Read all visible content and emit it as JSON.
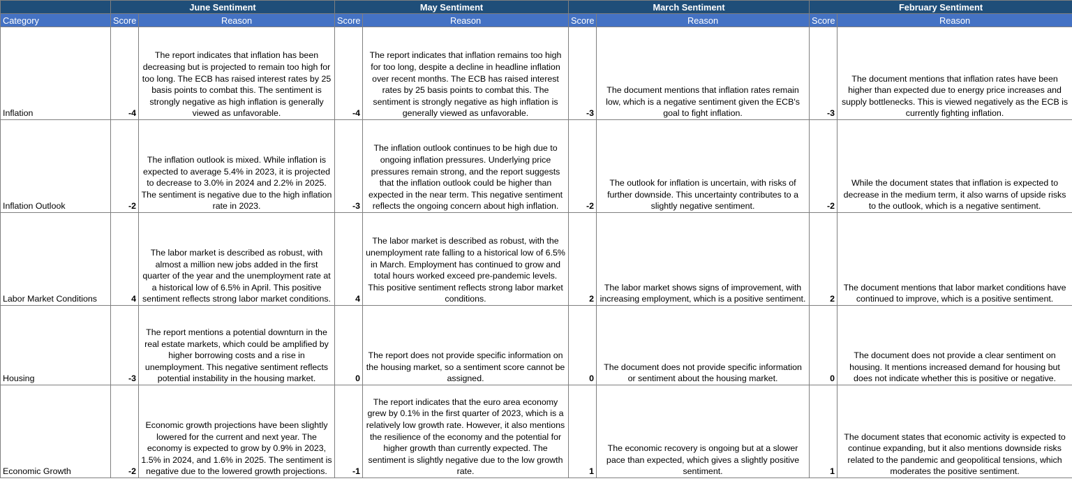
{
  "header": {
    "groups": [
      "June Sentiment",
      "May Sentiment",
      "March Sentiment",
      "February Sentiment"
    ],
    "category_label": "Category",
    "score_label": "Score",
    "reason_label": "Reason"
  },
  "rows": [
    {
      "category": "Inflation",
      "june": {
        "score": "-4",
        "reason": "The report indicates that inflation has been decreasing but is projected to remain too high for too long. The ECB has raised interest rates by 25 basis points to combat this. The sentiment is strongly negative as high inflation is generally viewed as unfavorable."
      },
      "may": {
        "score": "-4",
        "reason": "The report indicates that inflation remains too high for too long, despite a decline in headline inflation over recent months. The ECB has raised interest rates by 25 basis points to combat this. The sentiment is strongly negative as high inflation is generally viewed as unfavorable."
      },
      "march": {
        "score": "-3",
        "reason": "The document mentions that inflation rates remain low, which is a negative sentiment given the ECB's goal to fight inflation."
      },
      "february": {
        "score": "-3",
        "reason": "The document mentions that inflation rates have been higher than expected due to energy price increases and supply bottlenecks. This is viewed negatively as the ECB is currently fighting inflation."
      }
    },
    {
      "category": "Inflation Outlook",
      "june": {
        "score": "-2",
        "reason": "The inflation outlook is mixed. While inflation is expected to average 5.4% in 2023, it is projected to decrease to 3.0% in 2024 and 2.2% in 2025. The sentiment is negative due to the high inflation rate in 2023."
      },
      "may": {
        "score": "-3",
        "reason": "The inflation outlook continues to be high due to ongoing inflation pressures. Underlying price pressures remain strong, and the report suggests that the inflation outlook could be higher than expected in the near term. This negative sentiment reflects the ongoing concern about high inflation."
      },
      "march": {
        "score": "-2",
        "reason": "The outlook for inflation is uncertain, with risks of further downside. This uncertainty contributes to a slightly negative sentiment."
      },
      "february": {
        "score": "-2",
        "reason": "While the document states that inflation is expected to decrease in the medium term, it also warns of upside risks to the outlook, which is a negative sentiment."
      }
    },
    {
      "category": "Labor Market Conditions",
      "june": {
        "score": "4",
        "reason": "The labor market is described as robust, with almost a million new jobs added in the first quarter of the year and the unemployment rate at a historical low of 6.5% in April. This positive sentiment reflects strong labor market conditions."
      },
      "may": {
        "score": "4",
        "reason": "The labor market is described as robust, with the unemployment rate falling to a historical low of 6.5% in March. Employment has continued to grow and total hours worked exceed pre-pandemic levels. This positive sentiment reflects strong labor market conditions."
      },
      "march": {
        "score": "2",
        "reason": "The labor market shows signs of improvement, with increasing employment, which is a positive sentiment."
      },
      "february": {
        "score": "2",
        "reason": "The document mentions that labor market conditions have continued to improve, which is a positive sentiment."
      }
    },
    {
      "category": "Housing",
      "june": {
        "score": "-3",
        "reason": "The report mentions a potential downturn in the real estate markets, which could be amplified by higher borrowing costs and a rise in unemployment. This negative sentiment reflects potential instability in the housing market."
      },
      "may": {
        "score": "0",
        "reason": "The report does not provide specific information on the housing market, so a sentiment score cannot be assigned."
      },
      "march": {
        "score": "0",
        "reason": "The document does not provide specific information or sentiment about the housing market."
      },
      "february": {
        "score": "0",
        "reason": "The document does not provide a clear sentiment on housing. It mentions increased demand for housing but does not indicate whether this is positive or negative."
      }
    },
    {
      "category": "Economic Growth",
      "june": {
        "score": "-2",
        "reason": "Economic growth projections have been slightly lowered for the current and next year. The economy is expected to grow by 0.9% in 2023, 1.5% in 2024, and 1.6% in 2025. The sentiment is negative due to the lowered growth projections."
      },
      "may": {
        "score": "-1",
        "reason": "The report indicates that the euro area economy grew by 0.1% in the first quarter of 2023, which is a relatively low growth rate. However, it also mentions the resilience of the economy and the potential for higher growth than currently expected. The sentiment is slightly negative due to the low growth rate."
      },
      "march": {
        "score": "1",
        "reason": "The economic recovery is ongoing but at a slower pace than expected, which gives a slightly positive sentiment."
      },
      "february": {
        "score": "1",
        "reason": "The document states that economic activity is expected to continue expanding, but it also mentions downside risks related to the pandemic and geopolitical tensions, which moderates the positive sentiment."
      }
    }
  ]
}
